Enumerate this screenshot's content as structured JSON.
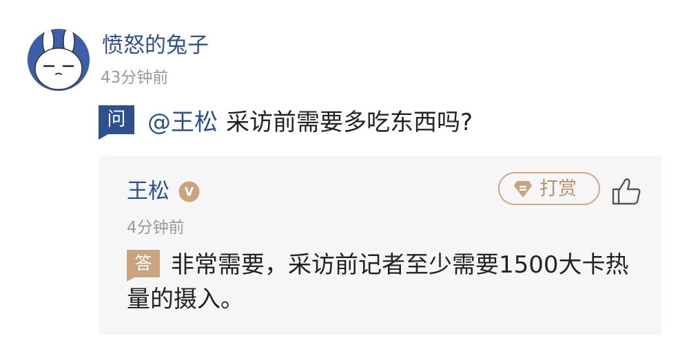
{
  "question": {
    "asker_name": "愤怒的兔子",
    "time": "43分钟前",
    "badge": "问",
    "mention": "@王松",
    "text": "采访前需要多吃东西吗?"
  },
  "answer": {
    "answerer_name": "王松",
    "verified_badge": "V",
    "tip_label": "打赏",
    "time": "4分钟前",
    "badge": "答",
    "text": "非常需要，采访前记者至少需要1500大卡热量的摄入。"
  },
  "colors": {
    "name_blue": "#2e5090",
    "question_badge": "#2e5090",
    "answer_badge": "#c9a47e",
    "tip_border": "#c9ab8c",
    "card_background": "#f6f6f6",
    "muted_text": "#9a9a9a"
  },
  "icons": {
    "avatar": "rabbit-avatar",
    "verified": "verified-v-icon",
    "tip": "gem-icon",
    "like": "thumbs-up-icon"
  }
}
